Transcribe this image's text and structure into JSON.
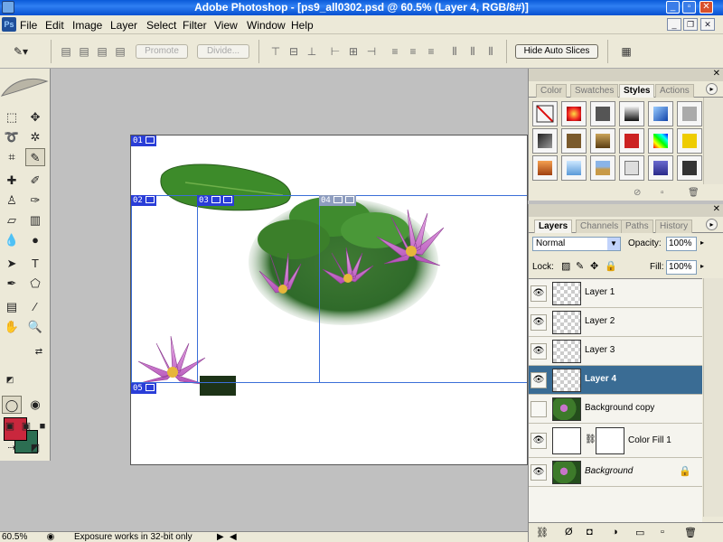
{
  "window": {
    "title": "Adobe Photoshop - [ps9_all0302.psd @ 60.5% (Layer 4, RGB/8#)]"
  },
  "menu": {
    "items": [
      "File",
      "Edit",
      "Image",
      "Layer",
      "Select",
      "Filter",
      "View",
      "Window",
      "Help"
    ]
  },
  "options": {
    "promote_label": "Promote",
    "divide_label": "Divide...",
    "hide_auto_slices_label": "Hide Auto Slices"
  },
  "slices": {
    "labels": [
      "01",
      "02",
      "03",
      "04",
      "05"
    ]
  },
  "styles_palette": {
    "tabs": [
      "Color",
      "Swatches",
      "Styles",
      "Actions"
    ],
    "active_tab": "Styles"
  },
  "layers_palette": {
    "tabs": [
      "Layers",
      "Channels",
      "Paths",
      "History"
    ],
    "blend_mode": "Normal",
    "opacity_label": "Opacity:",
    "opacity": "100%",
    "lock_label": "Lock:",
    "fill_label": "Fill:",
    "fill": "100%",
    "layers": [
      {
        "name": "Layer 1",
        "visible": true,
        "selected": false
      },
      {
        "name": "Layer 2",
        "visible": true,
        "selected": false
      },
      {
        "name": "Layer 3",
        "visible": true,
        "selected": false
      },
      {
        "name": "Layer 4",
        "visible": true,
        "selected": true
      },
      {
        "name": "Background copy",
        "visible": false,
        "selected": false
      },
      {
        "name": "Color Fill 1",
        "visible": true,
        "selected": false
      },
      {
        "name": "Background",
        "visible": true,
        "selected": false
      }
    ]
  },
  "status": {
    "zoom": "60.5%",
    "message": "Exposure works in 32-bit only"
  },
  "colors": {
    "foreground": "#c9273d",
    "background": "#2c6e52",
    "selected_layer": "#3a6c94",
    "user_slice": "#2a3ed8"
  }
}
